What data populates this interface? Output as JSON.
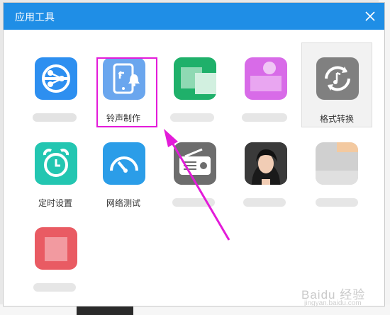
{
  "dialog": {
    "title": "应用工具",
    "close_icon": "close-icon"
  },
  "tools": [
    {
      "label": "",
      "icon": "share-icon",
      "color": "#2d8ff0"
    },
    {
      "label": "铃声制作",
      "icon": "ringtone-maker-icon",
      "color": "#6aa6ee"
    },
    {
      "label": "",
      "icon": "blurred-app-icon",
      "color": "#1fb06a"
    },
    {
      "label": "",
      "icon": "blurred-app-icon",
      "color": "#d86be8"
    },
    {
      "label": "格式转换",
      "icon": "format-convert-icon",
      "color": "#808080"
    },
    {
      "label": "定时设置",
      "icon": "alarm-clock-icon",
      "color": "#23c6b1"
    },
    {
      "label": "网络测试",
      "icon": "speedometer-icon",
      "color": "#2b9de8"
    },
    {
      "label": "",
      "icon": "radio-icon",
      "color": "#6d6d6d"
    },
    {
      "label": "",
      "icon": "portrait-photo-icon",
      "color": "#333333"
    },
    {
      "label": "",
      "icon": "blurred-app-icon",
      "color": "#d0d0d0"
    },
    {
      "label": "",
      "icon": "blurred-app-icon",
      "color": "#e95b63"
    }
  ],
  "watermark": {
    "text": "Baidu 经验",
    "url_text": "jingyan.baidu.com"
  },
  "colors": {
    "title_bar": "#1f8ee6",
    "highlight": "#e31bd9"
  }
}
